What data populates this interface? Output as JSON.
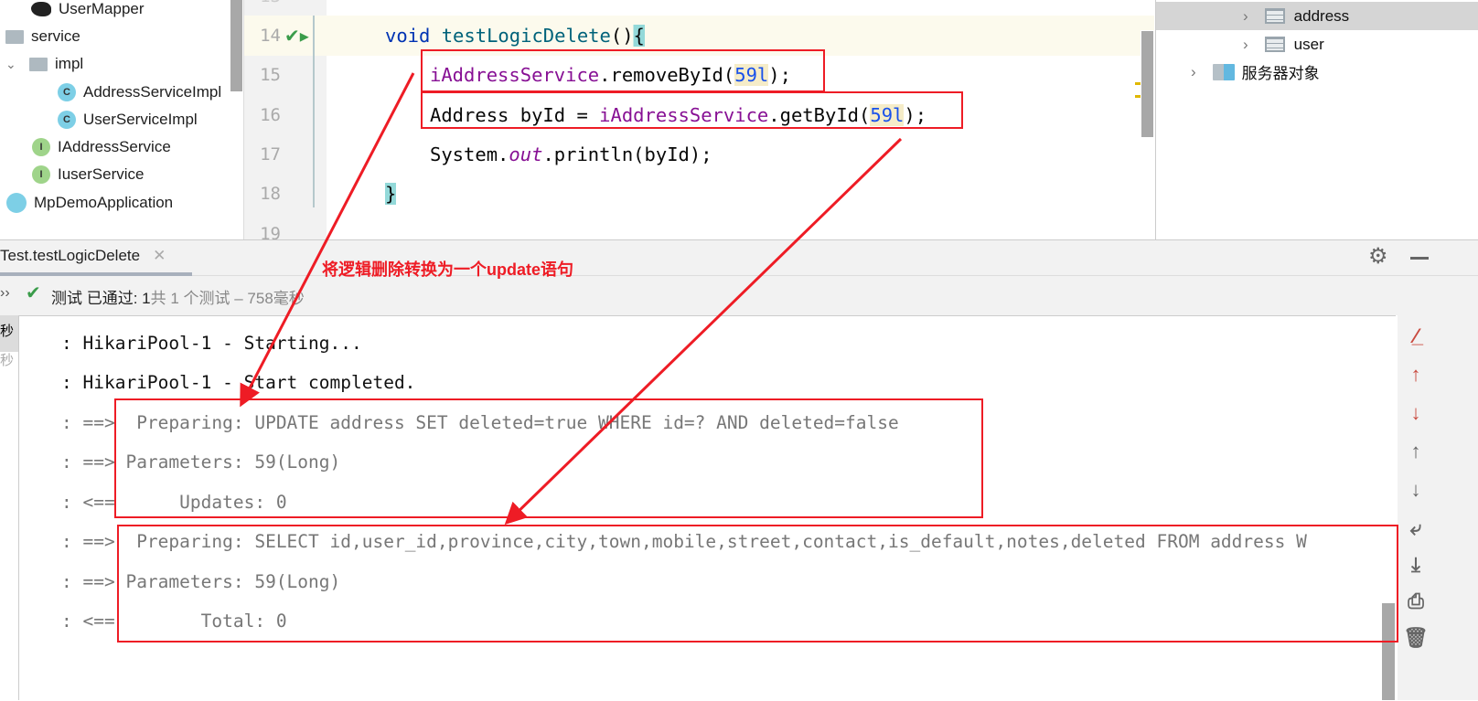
{
  "project_tree": {
    "items": [
      {
        "label": "UserMapper",
        "icon": "mapper-bird-icon"
      },
      {
        "label": "service",
        "icon": "folder-icon"
      },
      {
        "label": "impl",
        "icon": "folder-icon",
        "expanded": true
      },
      {
        "label": "AddressServiceImpl",
        "icon": "class-icon",
        "badge": "C"
      },
      {
        "label": "UserServiceImpl",
        "icon": "class-icon",
        "badge": "C"
      },
      {
        "label": "IAddressService",
        "icon": "interface-icon",
        "badge": "I"
      },
      {
        "label": "IuserService",
        "icon": "interface-icon",
        "badge": "I"
      },
      {
        "label": "MpDemoApplication",
        "icon": "spring-app-icon"
      }
    ]
  },
  "editor": {
    "lines": [
      {
        "n": "14"
      },
      {
        "n": "15"
      },
      {
        "n": "16"
      },
      {
        "n": "17"
      },
      {
        "n": "18"
      },
      {
        "n": "19"
      }
    ],
    "code": {
      "l14_kw": "void",
      "l14_fn": "testLogicDelete",
      "l14_rest": "(){",
      "l15_field": "iAddressService",
      "l15_mid": ".removeById(",
      "l15_num": "59l",
      "l15_end": ");",
      "l16_a": "Address byId = ",
      "l16_field": "iAddressService",
      "l16_mid": ".getById(",
      "l16_num": "59l",
      "l16_end": ");",
      "l17_a": "System.",
      "l17_out": "out",
      "l17_end": ".println(byId);",
      "l18": "}"
    }
  },
  "db_panel": {
    "items": [
      {
        "label": "address",
        "selected": true
      },
      {
        "label": "user"
      },
      {
        "label": "服务器对象"
      }
    ]
  },
  "run_panel": {
    "tab": "Test.testLogicDelete",
    "status_passed": "测试 已通过: 1",
    "status_rest": "共 1 个测试 – 758毫秒",
    "side_items": [
      "秒",
      "秒"
    ]
  },
  "console": {
    "lines": [
      {
        "prefix": ": ",
        "text": "HikariPool-1 - Starting..."
      },
      {
        "prefix": ": ",
        "text": "HikariPool-1 - Start completed."
      },
      {
        "prefix": ": ==> ",
        "text": " Preparing: UPDATE address SET deleted=true WHERE id=? AND deleted=false"
      },
      {
        "prefix": ": ==> ",
        "text": "Parameters: 59(Long)"
      },
      {
        "prefix": ": <== ",
        "text": "     Updates: 0"
      },
      {
        "prefix": ": ==> ",
        "text": " Preparing: SELECT id,user_id,province,city,town,mobile,street,contact,is_default,notes,deleted FROM address W"
      },
      {
        "prefix": ": ==> ",
        "text": "Parameters: 59(Long)"
      },
      {
        "prefix": ": <== ",
        "text": "       Total: 0"
      }
    ]
  },
  "annotation": {
    "text": "将逻辑删除转换为一个update语句",
    "color": "#ee1c25"
  }
}
